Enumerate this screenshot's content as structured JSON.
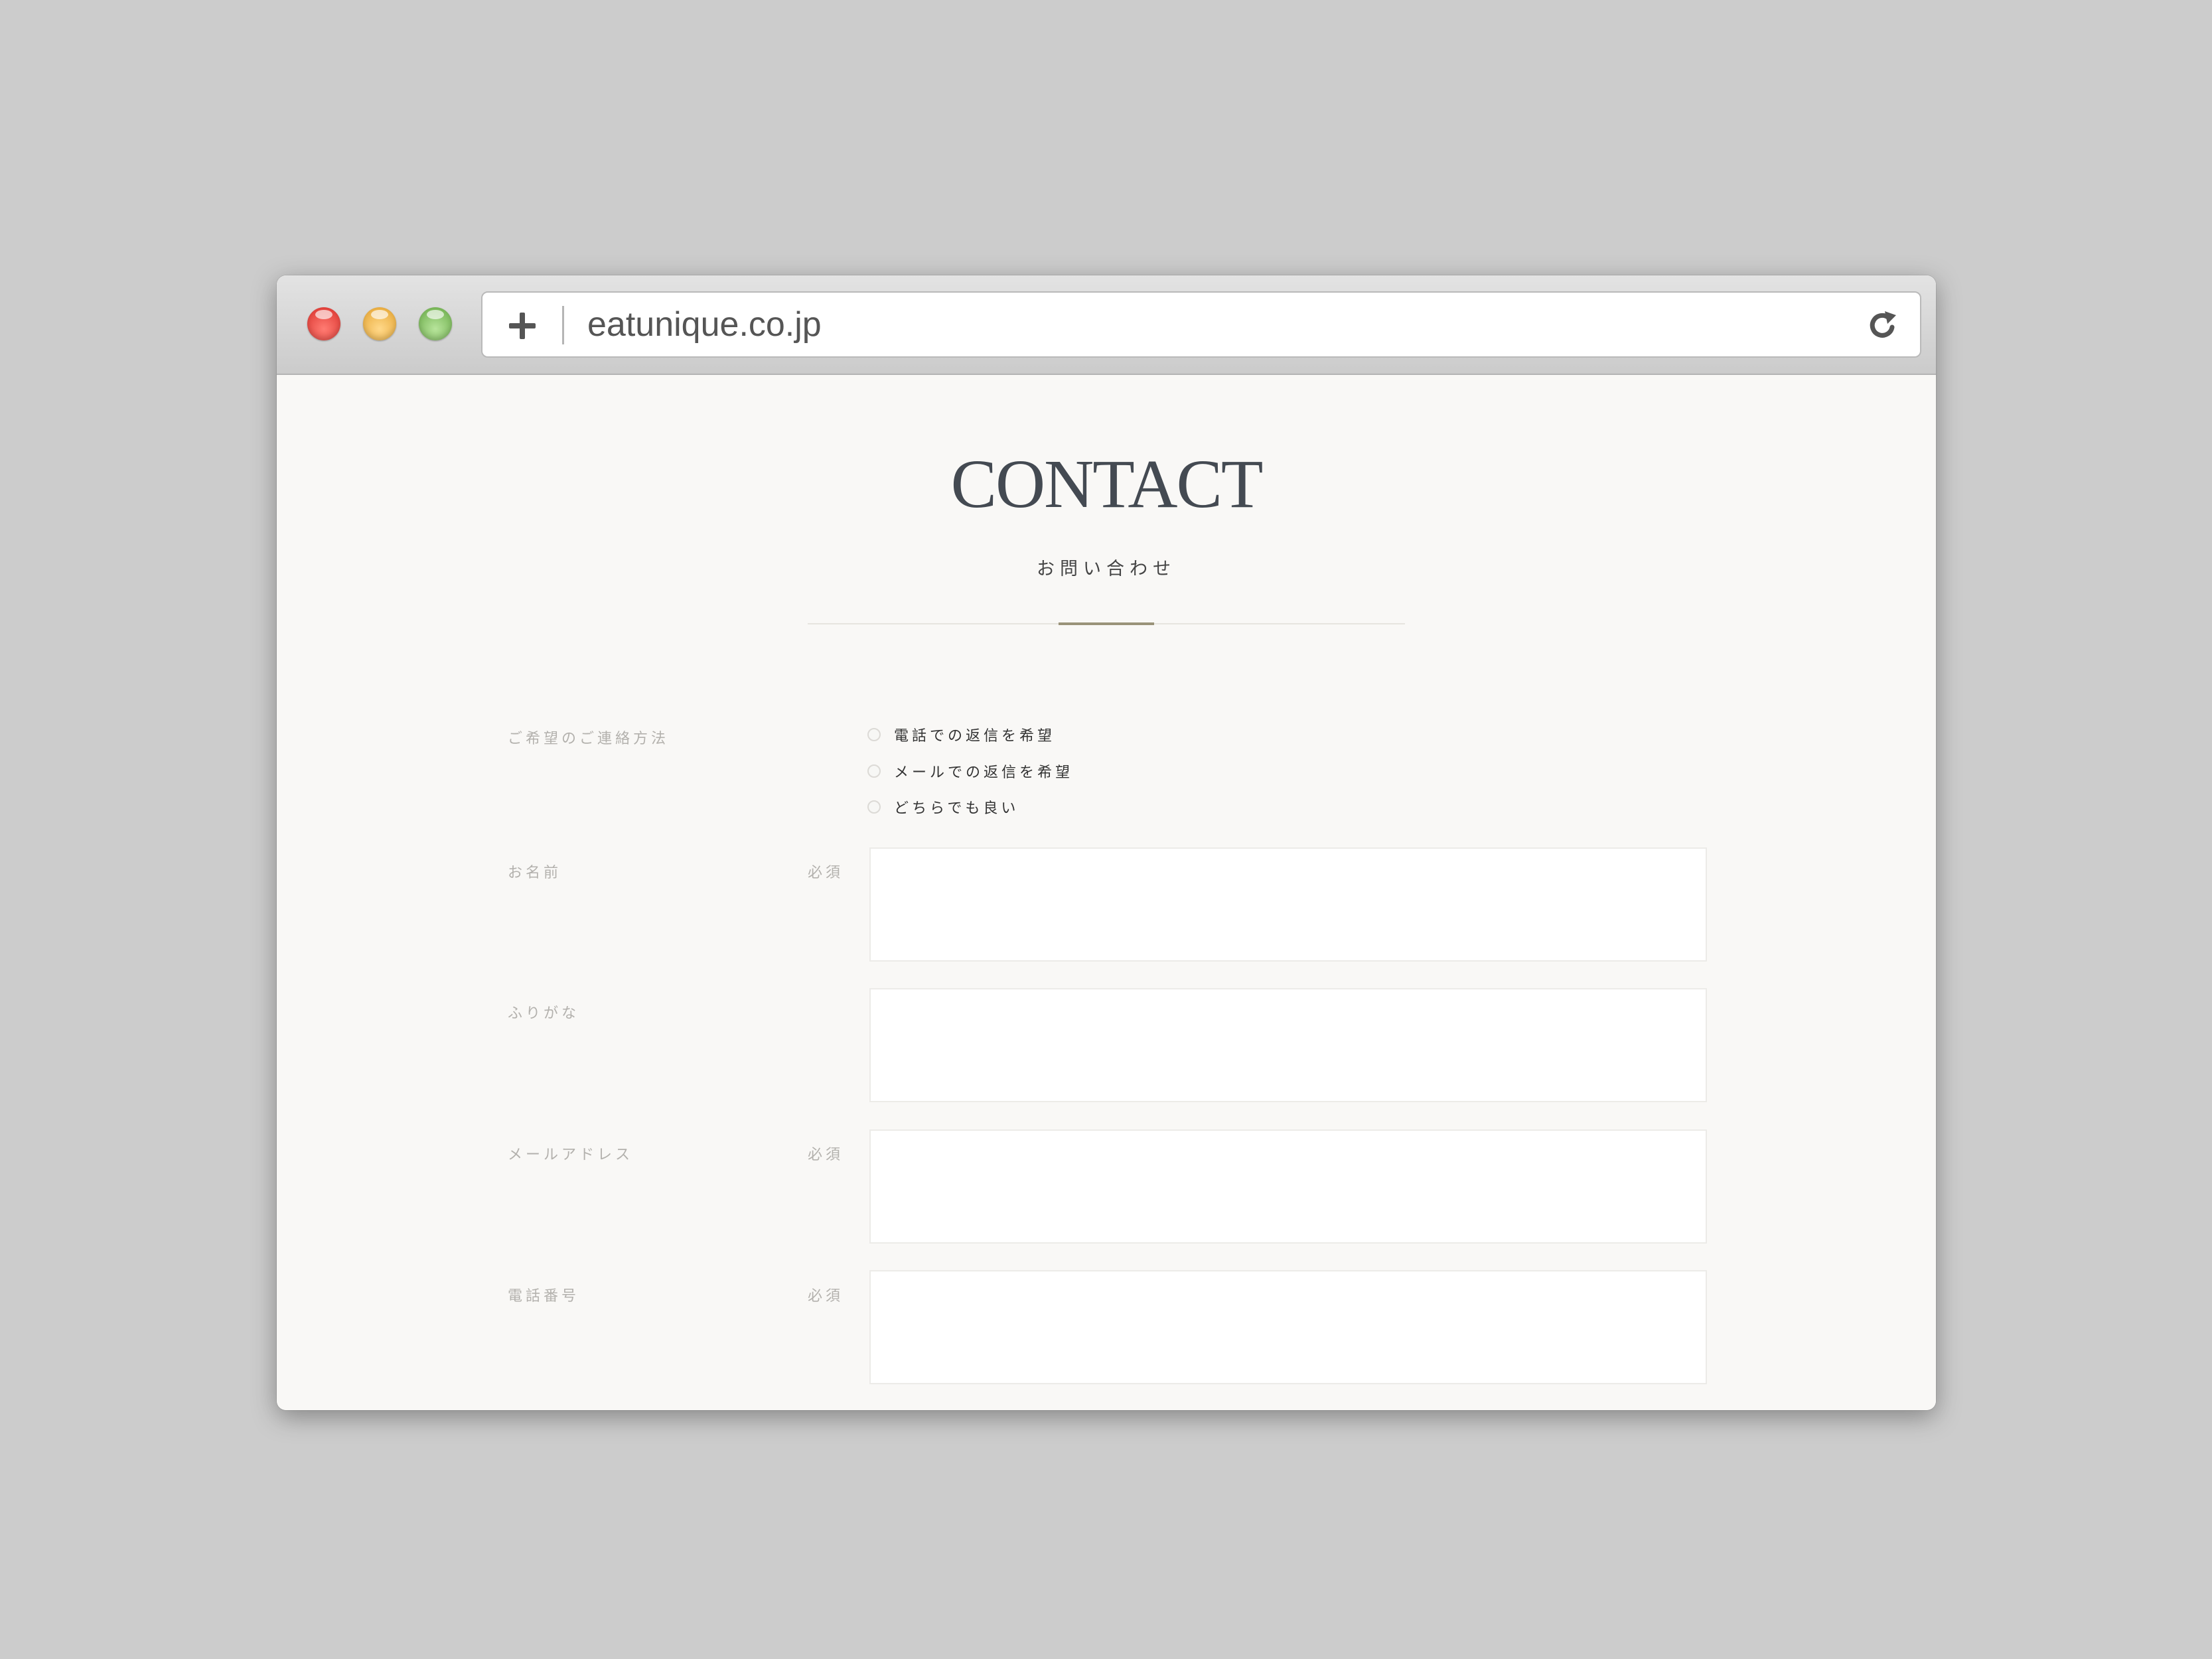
{
  "browser": {
    "url": "eatunique.co.jp",
    "new_tab_icon": "plus-icon",
    "reload_icon": "reload-icon"
  },
  "page": {
    "title": "CONTACT",
    "subtitle": "お問い合わせ"
  },
  "form": {
    "contact_method": {
      "label": "ご希望のご連絡方法",
      "options": [
        "電話での返信を希望",
        "メールでの返信を希望",
        "どちらでも良い"
      ]
    },
    "fields": [
      {
        "label": "お名前",
        "required": "必須"
      },
      {
        "label": "ふりがな",
        "required": ""
      },
      {
        "label": "メールアドレス",
        "required": "必須"
      },
      {
        "label": "電話番号",
        "required": "必須"
      }
    ]
  },
  "colors": {
    "page_background": "#f9f8f6",
    "title": "#444a52",
    "accent": "#9a9379",
    "muted_label": "#b3b1ad"
  }
}
